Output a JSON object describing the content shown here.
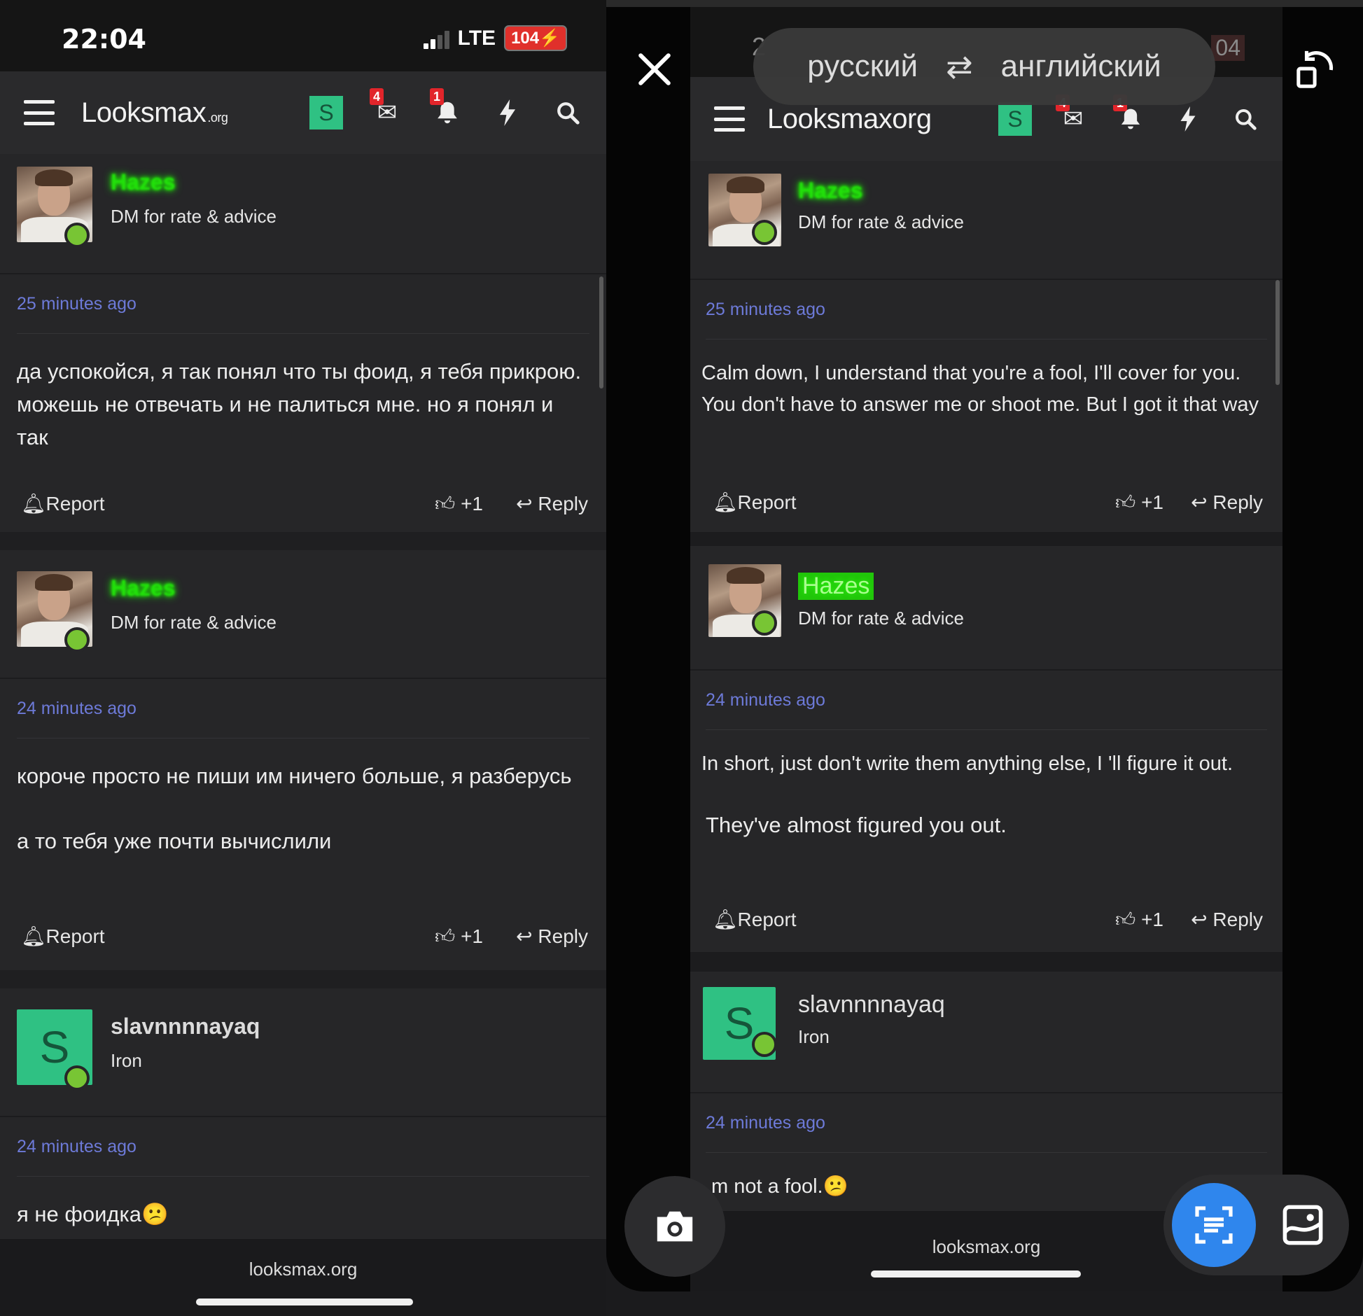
{
  "left": {
    "status": {
      "time": "22:04",
      "network": "LTE",
      "battery": "104"
    },
    "nav": {
      "logo_main": "Looksmax",
      "logo_suffix": ".org",
      "s_badge": "S",
      "inbox_count": "4",
      "alerts_count": "1"
    },
    "posts": [
      {
        "username": "Hazes",
        "user_title": "DM for rate & advice",
        "time": "25 minutes ago",
        "body": [
          "да успокойся, я так понял что ты фоид, я тебя прикрою. можешь не отвечать и не палиться мне. но я понял и так"
        ],
        "report": "Report",
        "likes": "+1",
        "reply": "Reply"
      },
      {
        "username": "Hazes",
        "user_title": "DM for rate & advice",
        "time": "24 minutes ago",
        "body": [
          "короче просто не пиши им ничего больше, я разберусь",
          "а то тебя уже почти вычислили"
        ],
        "report": "Report",
        "likes": "+1",
        "reply": "Reply"
      },
      {
        "username": "slavnnnnayaq",
        "user_title": "Iron",
        "avatar_letter": "S",
        "time": "24 minutes ago",
        "body": [
          "я не фоидка"
        ],
        "emoji": "😕"
      }
    ],
    "footer_url": "looksmax.org"
  },
  "right": {
    "overlay": {
      "source_lang": "русский",
      "target_lang": "английский"
    },
    "status_fragments": {
      "a": "2",
      "b": "04"
    },
    "nav": {
      "logo": "Looksmaxorg",
      "s_badge": "S",
      "inbox_count": "4",
      "alerts_count": "1"
    },
    "posts": [
      {
        "username": "Hazes",
        "user_title": "DM for rate & advice",
        "time": "25 minutes ago",
        "body": [
          "Calm down, I understand that you're a fool, I'll cover for you. You don't have to answer me or shoot me. But I got it that way"
        ],
        "report": "Report",
        "likes": "+1",
        "reply": "Reply"
      },
      {
        "username": "Hazes",
        "user_title": "DM for rate & advice",
        "time": "24 minutes ago",
        "body": [
          "In short, just don't write them anything else, I 'll figure it out.",
          "They've almost figured you out."
        ],
        "report": "Report",
        "likes": "+1",
        "reply": "Reply"
      },
      {
        "username": "slavnnnnayaq",
        "user_title": "Iron",
        "avatar_letter": "S",
        "time": "24 minutes ago",
        "body": [
          "m not a fool."
        ],
        "emoji": "😕"
      }
    ],
    "footer_url": "looksmax.org"
  },
  "icons": {
    "report": "bell-icon",
    "like": "thumbs-up-icon",
    "reply": "reply-arrow-icon",
    "inbox": "envelope-icon",
    "alerts": "bell-icon",
    "whats_new": "bolt-icon",
    "search": "search-icon",
    "close": "close-icon",
    "swap": "swap-languages-icon",
    "rotate": "rotate-icon",
    "camera": "camera-icon",
    "scan": "text-scan-icon",
    "gallery": "gallery-icon"
  },
  "colors": {
    "accent_green": "#2fc183",
    "username_glow": "#22e00b",
    "timestamp": "#6d7ad8",
    "scan_blue": "#2f86ed",
    "badge_red": "#e2252b"
  }
}
